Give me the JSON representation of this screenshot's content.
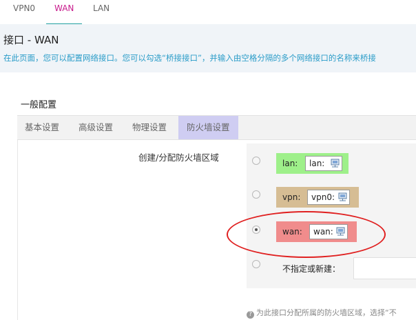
{
  "top_tabs": [
    {
      "label": "VPN0",
      "active": false
    },
    {
      "label": "WAN",
      "active": true
    },
    {
      "label": "LAN",
      "active": false
    }
  ],
  "page": {
    "title": "接口 - WAN",
    "description": "在此页面，您可以配置网络接口。您可以勾选“桥接接口”，并输入由空格分隔的多个网络接口的名称来桥接"
  },
  "section": {
    "title": "一般配置",
    "tabs": [
      {
        "label": "基本设置",
        "active": false
      },
      {
        "label": "高级设置",
        "active": false
      },
      {
        "label": "物理设置",
        "active": false
      },
      {
        "label": "防火墙设置",
        "active": true
      }
    ]
  },
  "firewall": {
    "label": "创建/分配防火墙区域",
    "zones": [
      {
        "name": "lan:",
        "chip": "lan:",
        "color": "#9ef08a",
        "selected": false
      },
      {
        "name": "vpn:",
        "chip": "vpn0:",
        "color": "#d6bd94",
        "selected": false
      },
      {
        "name": "wan:",
        "chip": "wan:",
        "color": "#f08c8c",
        "selected": true
      }
    ],
    "new_zone_label": "不指定或新建：",
    "new_zone_value": "",
    "help": "为此接口分配所属的防火墙区域，选择“不"
  },
  "colors": {
    "accent_tab": "#c81a8c",
    "tab_underline": "#20a0a0",
    "description": "#2a9cc8",
    "annotation": "#e02020"
  },
  "icons": {
    "chip_icon": "network-interface-icon",
    "help_icon": "question-circle-icon"
  }
}
